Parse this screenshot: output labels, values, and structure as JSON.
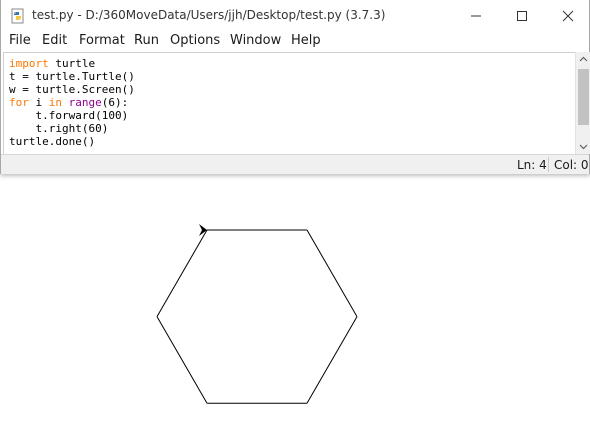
{
  "window": {
    "title": "test.py - D:/360MoveData/Users/jjh/Desktop/test.py (3.7.3)"
  },
  "menu": {
    "items": [
      "File",
      "Edit",
      "Format",
      "Run",
      "Options",
      "Window",
      "Help"
    ]
  },
  "editor": {
    "lines": [
      [
        {
          "t": "import",
          "c": "keyword"
        },
        {
          "t": " turtle",
          "c": "plain"
        }
      ],
      [
        {
          "t": "t = turtle.Turtle()",
          "c": "plain"
        }
      ],
      [
        {
          "t": "w = turtle.Screen()",
          "c": "plain"
        }
      ],
      [
        {
          "t": "for",
          "c": "keyword"
        },
        {
          "t": " i ",
          "c": "plain"
        },
        {
          "t": "in",
          "c": "keyword"
        },
        {
          "t": " ",
          "c": "plain"
        },
        {
          "t": "range",
          "c": "builtin"
        },
        {
          "t": "(6):",
          "c": "plain"
        }
      ],
      [
        {
          "t": "    t.forward(100)",
          "c": "plain"
        }
      ],
      [
        {
          "t": "    t.right(60)",
          "c": "plain"
        }
      ],
      [
        {
          "t": "turtle.done()",
          "c": "plain"
        }
      ]
    ],
    "colors": {
      "keyword": "#ff7700",
      "builtin": "#900090",
      "plain": "#000000"
    }
  },
  "status": {
    "ln": "Ln: 4",
    "col": "Col: 0"
  },
  "turtle_canvas": {
    "shape": "hexagon",
    "steps": 6,
    "forward": 100,
    "turn_right_degrees": 60,
    "pen_color": "#000000",
    "cursor_icon": "turtle-arrow-icon"
  }
}
